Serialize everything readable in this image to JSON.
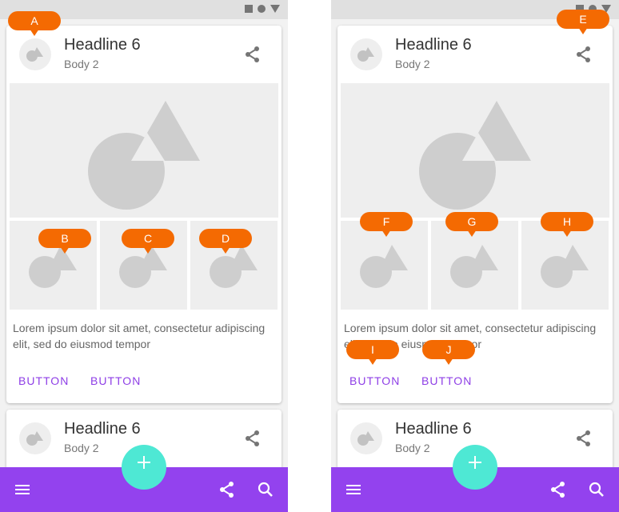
{
  "card": {
    "headline": "Headline 6",
    "subhead": "Body 2",
    "body_text": "Lorem ipsum dolor sit amet, consectetur adipiscing elit, sed do eiusmod tempor",
    "button_1": "BUTTON",
    "button_2": "BUTTON"
  },
  "second_card": {
    "headline": "Headline 6",
    "subhead": "Body 2"
  },
  "icons": {
    "share": "share-icon",
    "menu": "menu-icon",
    "search": "search-icon",
    "fab": "plus-icon"
  },
  "markers_left": [
    "A",
    "B",
    "C",
    "D"
  ],
  "markers_right": [
    "E",
    "F",
    "G",
    "H",
    "I",
    "J"
  ],
  "colors": {
    "app_bar": "#9342ee",
    "fab": "#4ee8d4",
    "button_text": "#8e3ee6",
    "marker": "#f46a02"
  }
}
